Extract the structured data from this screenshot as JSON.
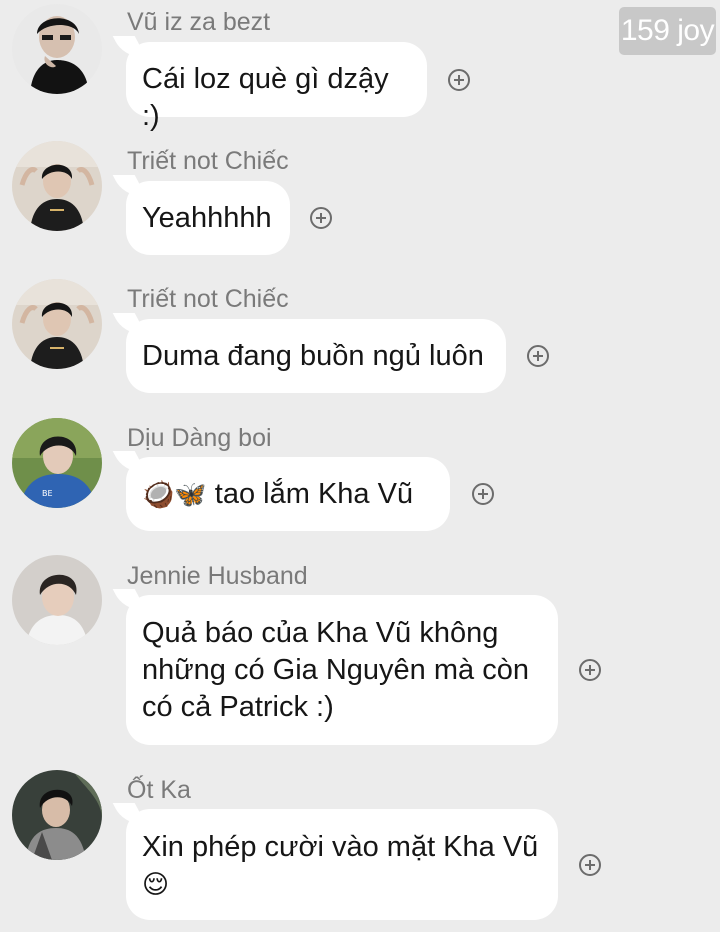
{
  "watermark": "159 joy",
  "messages": [
    {
      "sender": "Vũ iz za bezt",
      "text": "Cái loz què gì dzậy :)"
    },
    {
      "sender": "Triết not Chiếc",
      "text": "Yeahhhhh"
    },
    {
      "sender": "Triết not Chiếc",
      "text": "Duma đang buồn ngủ luôn"
    },
    {
      "sender": "Dịu Dàng boi",
      "emoji": "🥥🦋",
      "text": " tao lắm Kha Vũ"
    },
    {
      "sender": "Jennie Husband",
      "text": "Quả báo của Kha Vũ không những có Gia Nguyên mà còn có cả Patrick :)"
    },
    {
      "sender": "Ốt Ka",
      "text": "Xin phép cười vào mặt Kha Vũ",
      "emoji": "😌"
    }
  ],
  "icons": {
    "react": "circle-plus-icon"
  }
}
